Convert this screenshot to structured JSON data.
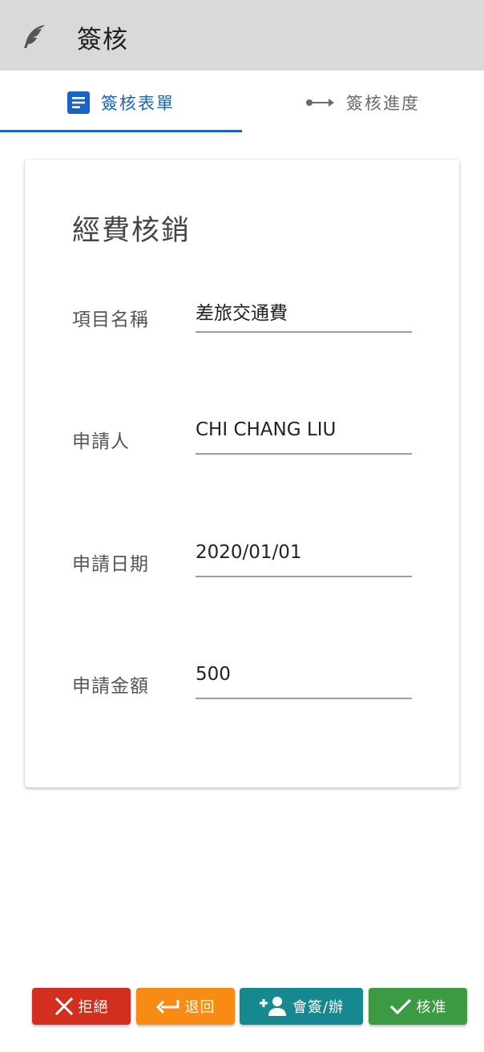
{
  "appbar": {
    "title": "簽核",
    "logo_icon": "feather-icon"
  },
  "tabs": [
    {
      "label": "簽核表單",
      "icon": "document-icon",
      "active": true
    },
    {
      "label": "簽核進度",
      "icon": "arrow-right-icon",
      "active": false
    }
  ],
  "colors": {
    "appbar_bg": "#d9d9d9",
    "accent": "#1a63c4",
    "reject": "#d32f1e",
    "return": "#f78b13",
    "cosign": "#16888f",
    "approve": "#3c9a42"
  },
  "form": {
    "title": "經費核銷",
    "fields": [
      {
        "label": "項目名稱",
        "value": "差旅交通費"
      },
      {
        "label": "申請人",
        "value": "CHI CHANG LIU"
      },
      {
        "label": "申請日期",
        "value": "2020/01/01"
      },
      {
        "label": "申請金額",
        "value": "500"
      }
    ]
  },
  "actions": {
    "reject": {
      "label": "拒絕",
      "icon": "close-icon"
    },
    "return": {
      "label": "退回",
      "icon": "return-arrow-icon"
    },
    "cosign": {
      "label": "會簽/辦",
      "icon": "add-person-icon"
    },
    "approve": {
      "label": "核准",
      "icon": "check-icon"
    }
  }
}
